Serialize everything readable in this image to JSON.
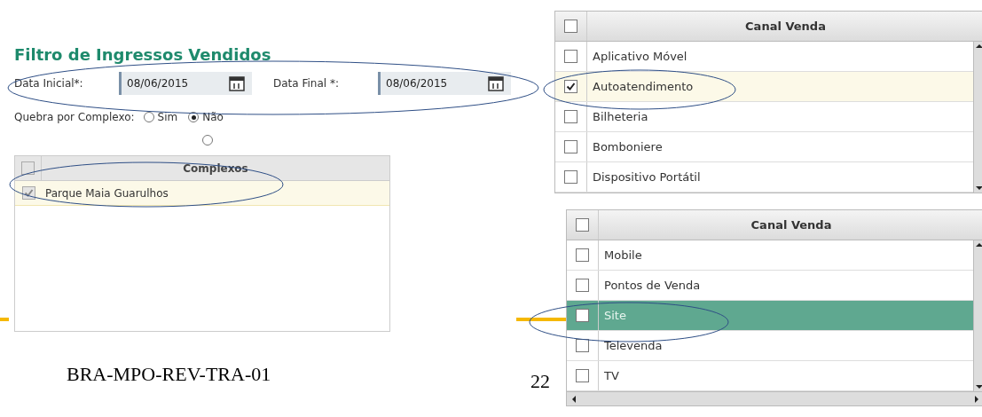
{
  "filter_panel": {
    "title": "Filtro de Ingressos Vendidos",
    "date_start": {
      "label": "Data Inicial*:",
      "value": "08/06/2015"
    },
    "date_end": {
      "label": "Data Final *:",
      "value": "08/06/2015"
    },
    "break_by_complex": {
      "label": "Quebra por Complexo:",
      "options": [
        {
          "label": "Sim",
          "selected": false
        },
        {
          "label": "Não",
          "selected": true
        }
      ],
      "extra_radio": {
        "selected": false
      }
    },
    "complexes": {
      "header_checked": false,
      "header_disabled": true,
      "column": "Complexos",
      "rows": [
        {
          "name": "Parque Maia Guarulhos",
          "checked": true,
          "disabled": true,
          "selected": true
        }
      ]
    }
  },
  "channel_list_1": {
    "header_checked": false,
    "column": "Canal Venda",
    "rows": [
      {
        "name": "Aplicativo Móvel",
        "checked": false,
        "selected": false
      },
      {
        "name": "Autoatendimento",
        "checked": true,
        "selected": true
      },
      {
        "name": "Bilheteria",
        "checked": false,
        "selected": false
      },
      {
        "name": "Bomboniere",
        "checked": false,
        "selected": false
      },
      {
        "name": "Dispositivo Portátil",
        "checked": false,
        "selected": false
      }
    ]
  },
  "channel_list_2": {
    "header_checked": false,
    "column": "Canal Venda",
    "rows": [
      {
        "name": "Mobile",
        "checked": false,
        "selected": false
      },
      {
        "name": "Pontos de Venda",
        "checked": false,
        "selected": false
      },
      {
        "name": "Site",
        "checked": false,
        "selected": true
      },
      {
        "name": "Televenda",
        "checked": false,
        "selected": false
      },
      {
        "name": "TV",
        "checked": false,
        "selected": false
      }
    ]
  },
  "footer": {
    "document_code": "BRA-MPO-REV-TRA-01",
    "page_number": "22"
  }
}
